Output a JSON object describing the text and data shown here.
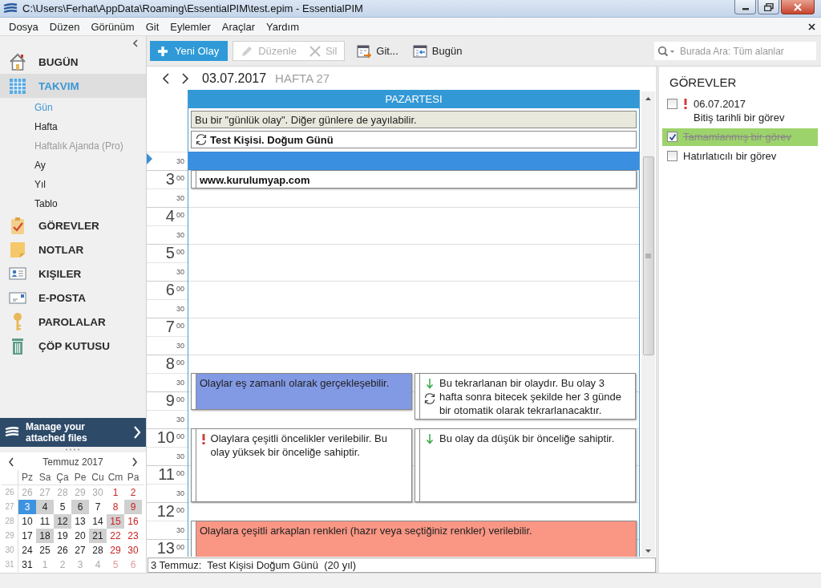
{
  "window": {
    "title": "C:\\Users\\Ferhat\\AppData\\Roaming\\EssentialPIM\\test.epim - EssentialPIM"
  },
  "menu": [
    "Dosya",
    "Düzen",
    "Görünüm",
    "Git",
    "Eylemler",
    "Araçlar",
    "Yardım"
  ],
  "sidebar": {
    "items": [
      {
        "label": "BUGÜN",
        "kind": "today",
        "selected": false
      },
      {
        "label": "TAKVIM",
        "kind": "calendar",
        "selected": true,
        "children": [
          {
            "label": "Gün",
            "selected": true,
            "disabled": false
          },
          {
            "label": "Hafta",
            "selected": false,
            "disabled": false
          },
          {
            "label": "Haftalık Ajanda (Pro)",
            "selected": false,
            "disabled": true
          },
          {
            "label": "Ay",
            "selected": false,
            "disabled": false
          },
          {
            "label": "Yıl",
            "selected": false,
            "disabled": false
          },
          {
            "label": "Tablo",
            "selected": false,
            "disabled": false
          }
        ]
      },
      {
        "label": "GÖREVLER",
        "kind": "tasks",
        "selected": false
      },
      {
        "label": "NOTLAR",
        "kind": "notes",
        "selected": false
      },
      {
        "label": "KIŞILER",
        "kind": "contacts",
        "selected": false
      },
      {
        "label": "E-POSTA",
        "kind": "email",
        "selected": false
      },
      {
        "label": "PAROLALAR",
        "kind": "passwords",
        "selected": false
      },
      {
        "label": "ÇÖP KUTUSU",
        "kind": "trash",
        "selected": false
      }
    ]
  },
  "banner": {
    "text": "Manage your attached files"
  },
  "mini_calendar": {
    "month": "Temmuz 2017",
    "weekdays": [
      "Pz",
      "Sa",
      "Ça",
      "Pe",
      "Cu",
      "Cm",
      "Pa"
    ],
    "weeks": [
      {
        "number": "26",
        "days": [
          {
            "label": "26",
            "other_month": true,
            "busy": false,
            "selected": false
          },
          {
            "label": "27",
            "other_month": true,
            "busy": false,
            "selected": false
          },
          {
            "label": "28",
            "other_month": true,
            "busy": false,
            "selected": false
          },
          {
            "label": "29",
            "other_month": true,
            "busy": false,
            "selected": false
          },
          {
            "label": "30",
            "other_month": true,
            "busy": false,
            "selected": false
          },
          {
            "label": "1",
            "other_month": false,
            "busy": false,
            "selected": false
          },
          {
            "label": "2",
            "other_month": false,
            "busy": false,
            "selected": false
          }
        ]
      },
      {
        "number": "27",
        "days": [
          {
            "label": "3",
            "other_month": false,
            "busy": false,
            "selected": true
          },
          {
            "label": "4",
            "other_month": false,
            "busy": true,
            "selected": false
          },
          {
            "label": "5",
            "other_month": false,
            "busy": false,
            "selected": false
          },
          {
            "label": "6",
            "other_month": false,
            "busy": true,
            "selected": false
          },
          {
            "label": "7",
            "other_month": false,
            "busy": false,
            "selected": false
          },
          {
            "label": "8",
            "other_month": false,
            "busy": false,
            "selected": false
          },
          {
            "label": "9",
            "other_month": false,
            "busy": true,
            "selected": false
          }
        ]
      },
      {
        "number": "28",
        "days": [
          {
            "label": "10",
            "other_month": false,
            "busy": false,
            "selected": false
          },
          {
            "label": "11",
            "other_month": false,
            "busy": false,
            "selected": false
          },
          {
            "label": "12",
            "other_month": false,
            "busy": true,
            "selected": false
          },
          {
            "label": "13",
            "other_month": false,
            "busy": false,
            "selected": false
          },
          {
            "label": "14",
            "other_month": false,
            "busy": false,
            "selected": false
          },
          {
            "label": "15",
            "other_month": false,
            "busy": true,
            "selected": false
          },
          {
            "label": "16",
            "other_month": false,
            "busy": false,
            "selected": false
          }
        ]
      },
      {
        "number": "29",
        "days": [
          {
            "label": "17",
            "other_month": false,
            "busy": false,
            "selected": false
          },
          {
            "label": "18",
            "other_month": false,
            "busy": true,
            "selected": false
          },
          {
            "label": "19",
            "other_month": false,
            "busy": false,
            "selected": false
          },
          {
            "label": "20",
            "other_month": false,
            "busy": false,
            "selected": false
          },
          {
            "label": "21",
            "other_month": false,
            "busy": true,
            "selected": false
          },
          {
            "label": "22",
            "other_month": false,
            "busy": false,
            "selected": false
          },
          {
            "label": "23",
            "other_month": false,
            "busy": false,
            "selected": false
          }
        ]
      },
      {
        "number": "30",
        "days": [
          {
            "label": "24",
            "other_month": false,
            "busy": false,
            "selected": false
          },
          {
            "label": "25",
            "other_month": false,
            "busy": false,
            "selected": false
          },
          {
            "label": "26",
            "other_month": false,
            "busy": false,
            "selected": false
          },
          {
            "label": "27",
            "other_month": false,
            "busy": false,
            "selected": false
          },
          {
            "label": "28",
            "other_month": false,
            "busy": false,
            "selected": false
          },
          {
            "label": "29",
            "other_month": false,
            "busy": false,
            "selected": false
          },
          {
            "label": "30",
            "other_month": false,
            "busy": false,
            "selected": false
          }
        ]
      },
      {
        "number": "31",
        "days": [
          {
            "label": "31",
            "other_month": false,
            "busy": false,
            "selected": false
          },
          {
            "label": "1",
            "other_month": true,
            "busy": false,
            "selected": false
          },
          {
            "label": "2",
            "other_month": true,
            "busy": false,
            "selected": false
          },
          {
            "label": "3",
            "other_month": true,
            "busy": false,
            "selected": false
          },
          {
            "label": "4",
            "other_month": true,
            "busy": false,
            "selected": false
          },
          {
            "label": "5",
            "other_month": true,
            "busy": false,
            "selected": false
          },
          {
            "label": "6",
            "other_month": true,
            "busy": false,
            "selected": false
          }
        ]
      }
    ]
  },
  "toolbar": {
    "buttons": [
      {
        "label": "Yeni Olay",
        "kind": "new",
        "disabled": false
      },
      {
        "label": "Düzenle",
        "kind": "edit",
        "disabled": true
      },
      {
        "label": "Sil",
        "kind": "delete",
        "disabled": true
      },
      {
        "label": "Git...",
        "kind": "goto",
        "disabled": false
      },
      {
        "label": "Bugün",
        "kind": "today",
        "disabled": false
      }
    ],
    "search": {
      "placeholder": "Burada Ara: Tüm alanlar"
    }
  },
  "day_view": {
    "date": "03.07.2017",
    "week": "HAFTA 27",
    "day": "PAZARTESI",
    "all_day": [
      {
        "text": "Bu bir \"günlük olay\". Diğer günlere de yayılabilir.",
        "color": "#e8e8dd",
        "recurring": false,
        "bold": false
      },
      {
        "text": "Test Kişisi. Doğum Günü",
        "color": "#ffffff",
        "recurring": true,
        "bold": true
      }
    ],
    "slots": [
      {
        "minute": "30",
        "selected": true
      },
      {
        "hour": "3",
        "minute": "00",
        "selected": false,
        "events": [
          {
            "text": "www.kurulumyap.com",
            "kind": "half",
            "color": "#ffffff",
            "high_priority": false,
            "low_priority": false,
            "recurring": false,
            "bold": true
          }
        ]
      },
      {
        "minute": "30",
        "selected": false
      },
      {
        "hour": "4",
        "minute": "00",
        "selected": false
      },
      {
        "minute": "30",
        "selected": false
      },
      {
        "hour": "5",
        "minute": "00",
        "selected": false
      },
      {
        "minute": "30",
        "selected": false
      },
      {
        "hour": "6",
        "minute": "00",
        "selected": false
      },
      {
        "minute": "30",
        "selected": false
      },
      {
        "hour": "7",
        "minute": "00",
        "selected": false
      },
      {
        "minute": "30",
        "selected": false
      },
      {
        "hour": "8",
        "minute": "00",
        "selected": false
      },
      {
        "minute": "30",
        "selected": false,
        "events": [
          {
            "text": "Olaylar eş zamanlı olarak gerçekleşebilir.",
            "kind": "hour",
            "color": "#8299e4",
            "high_priority": false,
            "low_priority": false,
            "recurring": false,
            "bold": false
          },
          {
            "text": "Bu tekrarlanan bir olaydır. Bu olay 3 hafta sonra bitecek şekilde her 3 günde bir otomatik olarak tekrarlanacaktır.",
            "kind": "extended",
            "color": "#ffffff",
            "high_priority": false,
            "low_priority": true,
            "recurring": true,
            "bold": false
          }
        ]
      },
      {
        "hour": "9",
        "minute": "00",
        "selected": false
      },
      {
        "minute": "30",
        "selected": false
      },
      {
        "hour": "10",
        "minute": "00",
        "selected": false,
        "events": [
          {
            "text": "Olaylara çeşitli öncelikler verilebilir. Bu olay yüksek bir önceliğe sahiptir.",
            "kind": "double",
            "color": "#ffffff",
            "high_priority": true,
            "low_priority": false,
            "recurring": false,
            "bold": false
          },
          {
            "text": "Bu olay da düşük bir önceliğe sahiptir.",
            "kind": "double",
            "color": "#ffffff",
            "high_priority": false,
            "low_priority": true,
            "recurring": false,
            "bold": false
          }
        ]
      },
      {
        "minute": "30",
        "selected": false
      },
      {
        "hour": "11",
        "minute": "00",
        "selected": false
      },
      {
        "minute": "30",
        "selected": false
      },
      {
        "hour": "12",
        "minute": "00",
        "selected": false
      },
      {
        "minute": "30",
        "selected": false,
        "events": [
          {
            "text": "Olaylara çeşitli arkaplan renkleri (hazır veya seçtiğiniz renkler) verilebilir.",
            "kind": "tall",
            "color": "#f99684",
            "high_priority": false,
            "low_priority": false,
            "recurring": false,
            "bold": false
          }
        ]
      },
      {
        "hour": "13",
        "minute": "00",
        "selected": false
      }
    ],
    "footer": "3 Temmuz:  Test Kişisi Doğum Günü  (20 yıl)"
  },
  "tasks": {
    "title": "GÖREVLER",
    "items": [
      {
        "date": "06.07.2017",
        "label": "Bitiş tarihli bir görev",
        "checked": false,
        "high_priority": true
      },
      {
        "label": "Tamamlanmış bir görev",
        "checked": true,
        "high_priority": false
      },
      {
        "label": "Hatırlatıcılı bir görev",
        "checked": false,
        "high_priority": false
      }
    ]
  }
}
